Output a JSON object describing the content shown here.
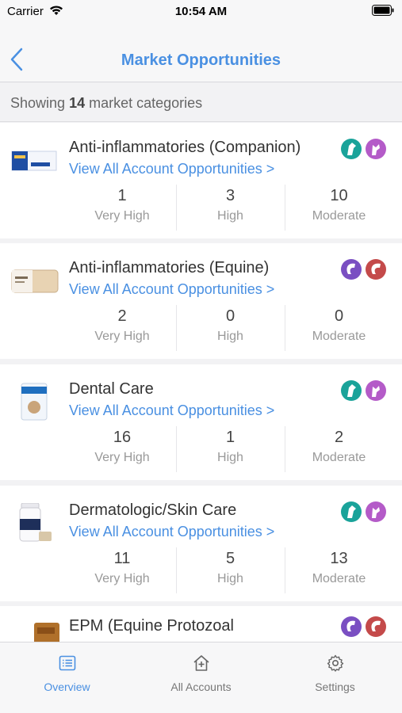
{
  "status": {
    "carrier": "Carrier",
    "time": "10:54 AM"
  },
  "nav": {
    "title": "Market Opportunities"
  },
  "summary": {
    "prefix": "Showing",
    "count": "14",
    "suffix": "market categories"
  },
  "categories": [
    {
      "title": "Anti-inflammatories (Companion)",
      "link": "View All Account Opportunities >",
      "species": [
        "dog",
        "cat"
      ],
      "stats": [
        {
          "value": "1",
          "label": "Very High"
        },
        {
          "value": "3",
          "label": "High"
        },
        {
          "value": "10",
          "label": "Moderate"
        }
      ]
    },
    {
      "title": "Anti-inflammatories (Equine)",
      "link": "View All Account Opportunities >",
      "species": [
        "horse",
        "cattle"
      ],
      "stats": [
        {
          "value": "2",
          "label": "Very High"
        },
        {
          "value": "0",
          "label": "High"
        },
        {
          "value": "0",
          "label": "Moderate"
        }
      ]
    },
    {
      "title": "Dental Care",
      "link": "View All Account Opportunities >",
      "species": [
        "dog",
        "cat"
      ],
      "stats": [
        {
          "value": "16",
          "label": "Very High"
        },
        {
          "value": "1",
          "label": "High"
        },
        {
          "value": "2",
          "label": "Moderate"
        }
      ]
    },
    {
      "title": "Dermatologic/Skin Care",
      "link": "View All Account Opportunities >",
      "species": [
        "dog",
        "cat"
      ],
      "stats": [
        {
          "value": "11",
          "label": "Very High"
        },
        {
          "value": "5",
          "label": "High"
        },
        {
          "value": "13",
          "label": "Moderate"
        }
      ]
    },
    {
      "title": "EPM (Equine Protozoal",
      "link": "",
      "species": [
        "horse",
        "cattle"
      ],
      "stats": []
    }
  ],
  "tabs": [
    {
      "label": "Overview",
      "icon": "list-icon",
      "active": true
    },
    {
      "label": "All Accounts",
      "icon": "home-plus-icon",
      "active": false
    },
    {
      "label": "Settings",
      "icon": "gear-icon",
      "active": false
    }
  ],
  "colors": {
    "accent": "#4a90e2",
    "dog": "#1aa39a",
    "cat": "#b45bc8",
    "horse": "#7a4fc2",
    "cattle": "#c44a4a"
  }
}
